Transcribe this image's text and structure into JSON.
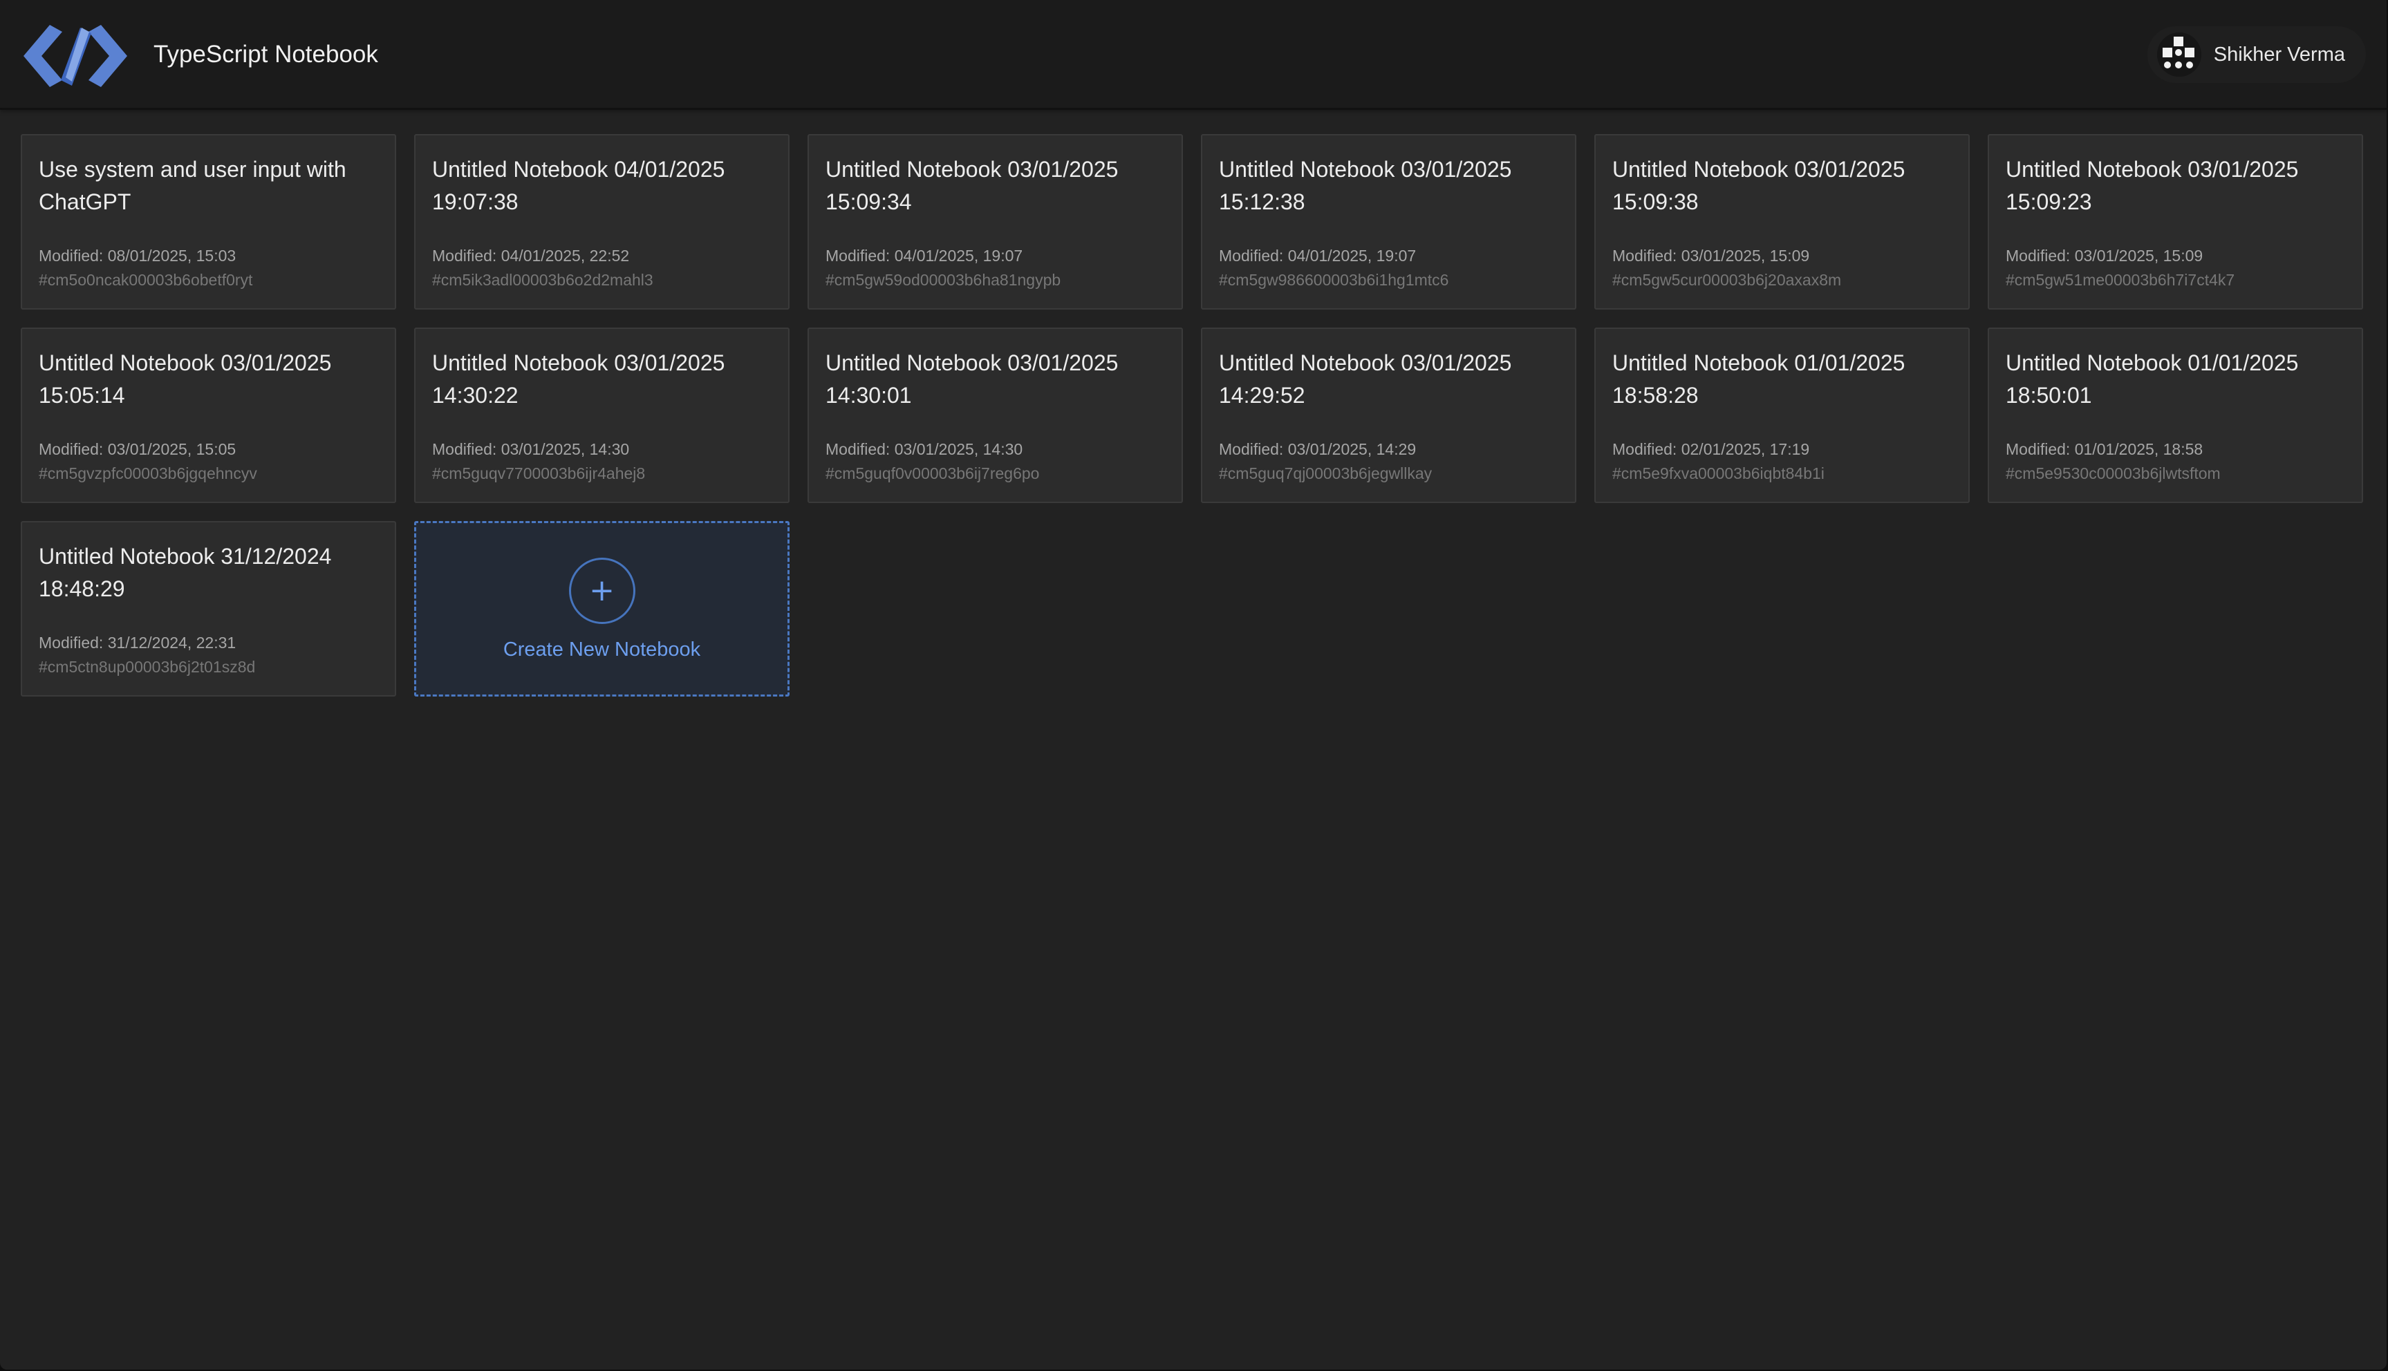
{
  "header": {
    "app_title": "TypeScript Notebook",
    "logo_icon": "code-brackets-logo",
    "user_name": "Shikher Verma",
    "avatar_icon": "pixel-avatar"
  },
  "notebooks": [
    {
      "title": "Use system and user input with ChatGPT",
      "modified": "Modified: 08/01/2025, 15:03",
      "id": "#cm5o0ncak00003b6obetf0ryt"
    },
    {
      "title": "Untitled Notebook 04/01/2025 19:07:38",
      "modified": "Modified: 04/01/2025, 22:52",
      "id": "#cm5ik3adl00003b6o2d2mahl3"
    },
    {
      "title": "Untitled Notebook 03/01/2025 15:09:34",
      "modified": "Modified: 04/01/2025, 19:07",
      "id": "#cm5gw59od00003b6ha81ngypb"
    },
    {
      "title": "Untitled Notebook 03/01/2025 15:12:38",
      "modified": "Modified: 04/01/2025, 19:07",
      "id": "#cm5gw986600003b6i1hg1mtc6"
    },
    {
      "title": "Untitled Notebook 03/01/2025 15:09:38",
      "modified": "Modified: 03/01/2025, 15:09",
      "id": "#cm5gw5cur00003b6j20axax8m"
    },
    {
      "title": "Untitled Notebook 03/01/2025 15:09:23",
      "modified": "Modified: 03/01/2025, 15:09",
      "id": "#cm5gw51me00003b6h7i7ct4k7"
    },
    {
      "title": "Untitled Notebook 03/01/2025 15:05:14",
      "modified": "Modified: 03/01/2025, 15:05",
      "id": "#cm5gvzpfc00003b6jgqehncyv"
    },
    {
      "title": "Untitled Notebook 03/01/2025 14:30:22",
      "modified": "Modified: 03/01/2025, 14:30",
      "id": "#cm5guqv7700003b6ijr4ahej8"
    },
    {
      "title": "Untitled Notebook 03/01/2025 14:30:01",
      "modified": "Modified: 03/01/2025, 14:30",
      "id": "#cm5guqf0v00003b6ij7reg6po"
    },
    {
      "title": "Untitled Notebook 03/01/2025 14:29:52",
      "modified": "Modified: 03/01/2025, 14:29",
      "id": "#cm5guq7qj00003b6jegwllkay"
    },
    {
      "title": "Untitled Notebook 01/01/2025 18:58:28",
      "modified": "Modified: 02/01/2025, 17:19",
      "id": "#cm5e9fxva00003b6iqbt84b1i"
    },
    {
      "title": "Untitled Notebook 01/01/2025 18:50:01",
      "modified": "Modified: 01/01/2025, 18:58",
      "id": "#cm5e9530c00003b6jlwtsftom"
    },
    {
      "title": "Untitled Notebook 31/12/2024 18:48:29",
      "modified": "Modified: 31/12/2024, 22:31",
      "id": "#cm5ctn8up00003b6j2t01sz8d"
    }
  ],
  "create_card": {
    "plus": "+",
    "label": "Create New Notebook",
    "icon": "plus-icon"
  },
  "colors": {
    "background": "#222222",
    "topbar": "#1b1b1b",
    "card": "#2c2c2c",
    "accent": "#6d9fef"
  }
}
